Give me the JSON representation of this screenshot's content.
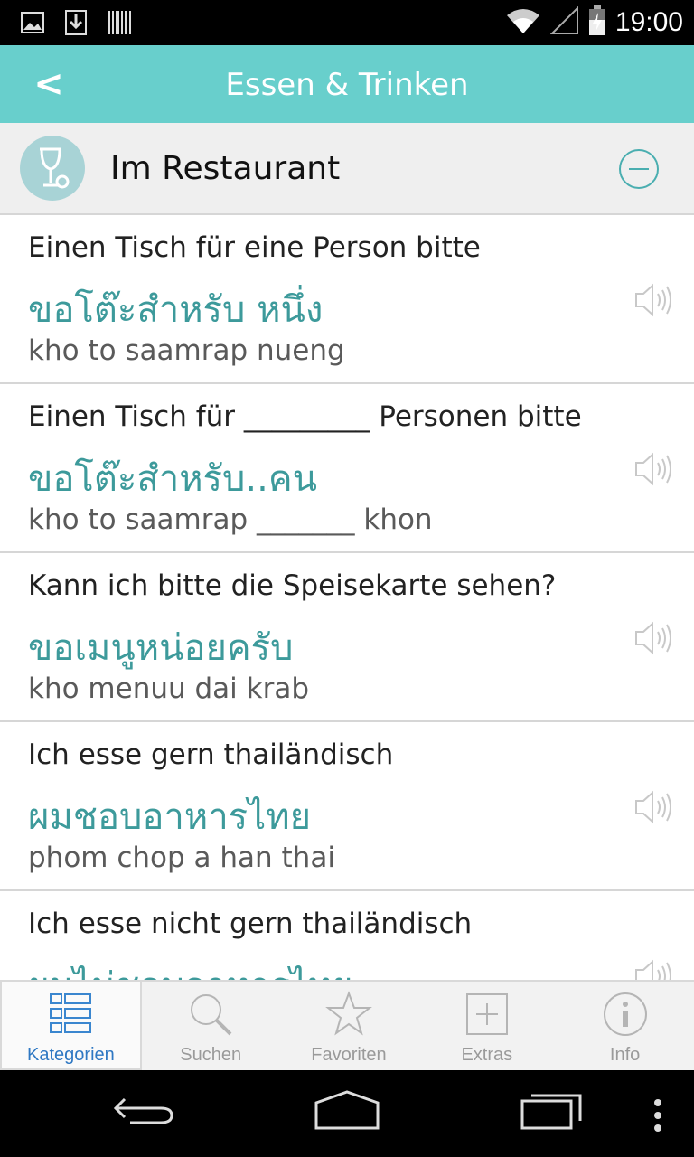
{
  "status_bar": {
    "time": "19:00",
    "left_icons": [
      "image-icon",
      "download-icon",
      "barcode-icon"
    ],
    "right_icons": [
      "wifi-icon",
      "signal-icon",
      "battery-icon"
    ]
  },
  "action_bar": {
    "back_label": "<",
    "title": "Essen & Trinken"
  },
  "category": {
    "title": "Im Restaurant",
    "icon": "wine-glass-icon"
  },
  "phrases": [
    {
      "german": "Einen Tisch für eine Person bitte",
      "thai": "ขอโต๊ะสำหรับ หนึ่ง",
      "transliteration": "kho to saamrap nueng"
    },
    {
      "german": "Einen Tisch für _________ Personen bitte",
      "thai": "ขอโต๊ะสำหรับ..คน",
      "transliteration": "kho to saamrap _______ khon"
    },
    {
      "german": "Kann ich bitte die Speisekarte sehen?",
      "thai": "ขอเมนูหน่อยครับ",
      "transliteration": "kho menuu dai krab"
    },
    {
      "german": "Ich esse gern thailändisch",
      "thai": "ผมชอบอาหารไทย",
      "transliteration": "phom chop a han thai"
    },
    {
      "german": "Ich esse nicht gern thailändisch",
      "thai": "ผมไม่ชอบอาหารไทย",
      "transliteration": ""
    }
  ],
  "tabs": [
    {
      "label": "Kategorien",
      "icon": "list-icon",
      "active": true
    },
    {
      "label": "Suchen",
      "icon": "search-icon",
      "active": false
    },
    {
      "label": "Favoriten",
      "icon": "star-icon",
      "active": false
    },
    {
      "label": "Extras",
      "icon": "plus-box-icon",
      "active": false
    },
    {
      "label": "Info",
      "icon": "info-icon",
      "active": false
    }
  ],
  "colors": {
    "accent": "#68cfcc",
    "thai_text": "#3d9a9b",
    "active_tab": "#2f78c3"
  }
}
